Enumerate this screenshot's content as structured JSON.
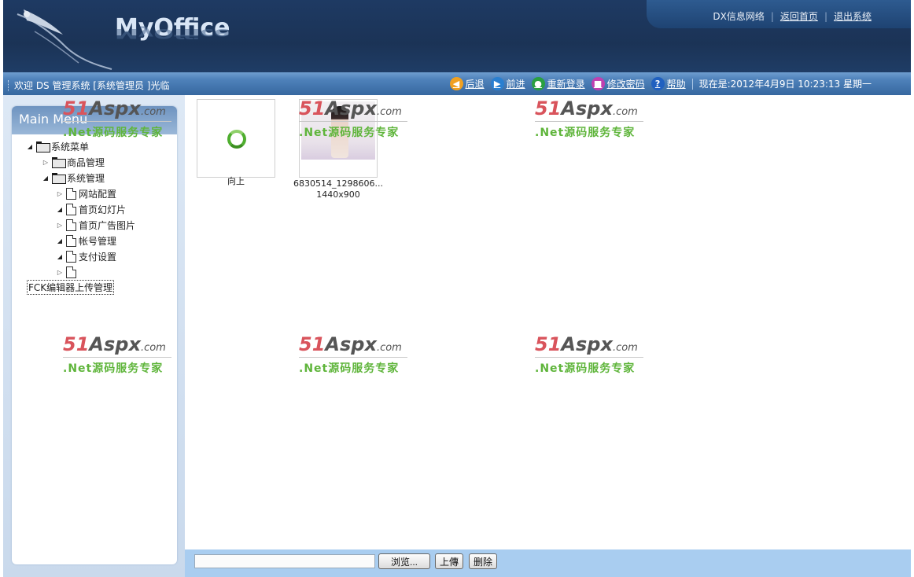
{
  "header": {
    "logo": "MyOffice",
    "links": [
      "DX信息网络",
      "返回首页",
      "退出系统"
    ]
  },
  "statusbar": {
    "welcome": "欢迎 DS 管理系统 [系统管理员 ]光临",
    "nav": [
      {
        "label": "后退",
        "icon": "back-icon",
        "color": "#f0a020"
      },
      {
        "label": "前进",
        "icon": "forward-icon",
        "color": "#2a7fd0"
      },
      {
        "label": "重新登录",
        "icon": "relogin-icon",
        "color": "#2aa040"
      },
      {
        "label": "修改密码",
        "icon": "password-icon",
        "color": "#c040b0"
      },
      {
        "label": "帮助",
        "icon": "help-icon",
        "color": "#2060c0"
      }
    ],
    "datetime": "现在是:2012年4月9日  10:23:13 星期一"
  },
  "sidebar": {
    "title": "Main Menu",
    "tree": [
      {
        "label": "系统菜单",
        "level": 0,
        "expanded": true,
        "type": "folder"
      },
      {
        "label": "商品管理",
        "level": 1,
        "expanded": false,
        "type": "folder"
      },
      {
        "label": "系统管理",
        "level": 1,
        "expanded": true,
        "type": "folder"
      },
      {
        "label": "网站配置",
        "level": 2,
        "expanded": false,
        "type": "doc"
      },
      {
        "label": "首页幻灯片",
        "level": 2,
        "expanded": true,
        "type": "doc"
      },
      {
        "label": "首页广告图片",
        "level": 2,
        "expanded": false,
        "type": "doc"
      },
      {
        "label": "帐号管理",
        "level": 2,
        "expanded": true,
        "type": "doc"
      },
      {
        "label": "支付设置",
        "level": 2,
        "expanded": true,
        "type": "doc"
      },
      {
        "label": "",
        "level": 2,
        "expanded": false,
        "type": "doc"
      }
    ],
    "selected": "FCK编辑器上传管理"
  },
  "files": [
    {
      "name": "向上",
      "dims": "",
      "kind": "up"
    },
    {
      "name": "6830514_1298606...",
      "dims": "1440x900",
      "kind": "image"
    }
  ],
  "upload": {
    "browse": "浏览...",
    "upload": "上傳",
    "delete": "删除"
  },
  "watermark": {
    "brand_num": "51",
    "brand_aspx": "Aspx",
    "brand_com": ".com",
    "tagline": ".Net源码服务专家"
  }
}
